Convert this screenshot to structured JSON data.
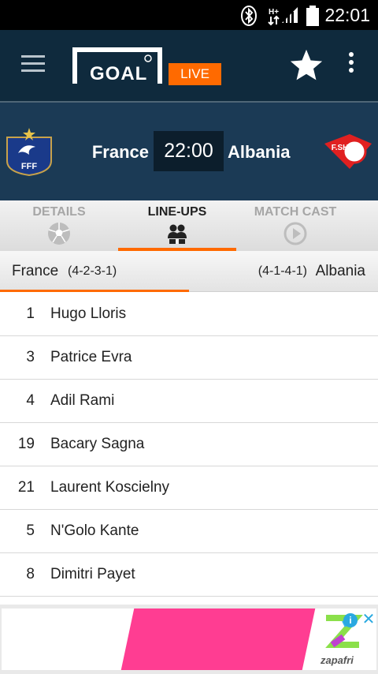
{
  "status_bar": {
    "time": "22:01",
    "icons": [
      "bluetooth-icon",
      "network-hplus-icon",
      "signal-icon",
      "battery-icon"
    ],
    "network_label": "H+"
  },
  "app_bar": {
    "logo_text": "GOAL",
    "live_label": "LIVE",
    "icons": [
      "menu-icon",
      "star-icon",
      "more-vert-icon"
    ]
  },
  "match": {
    "home_team": "France",
    "away_team": "Albania",
    "kickoff": "22:00",
    "home_crest_text": "FFF",
    "away_crest_text": "F.SH.F"
  },
  "tabs": [
    {
      "label": "DETAILS",
      "icon": "soccer-ball-icon",
      "active": false
    },
    {
      "label": "LINE-UPS",
      "icon": "players-icon",
      "active": true
    },
    {
      "label": "MATCH CAST",
      "icon": "play-circle-icon",
      "active": false
    }
  ],
  "lineups": {
    "home_name": "France",
    "home_formation": "(4-2-3-1)",
    "away_formation": "(4-1-4-1)",
    "away_name": "Albania",
    "players": [
      {
        "number": "1",
        "name": "Hugo Lloris"
      },
      {
        "number": "3",
        "name": "Patrice Evra"
      },
      {
        "number": "4",
        "name": "Adil Rami"
      },
      {
        "number": "19",
        "name": "Bacary Sagna"
      },
      {
        "number": "21",
        "name": "Laurent Koscielny"
      },
      {
        "number": "5",
        "name": "N'Golo Kante"
      },
      {
        "number": "8",
        "name": "Dimitri Payet"
      }
    ]
  },
  "ad": {
    "brand": "zapafri",
    "info_label": "i",
    "close_label": "✕"
  },
  "colors": {
    "app_bar": "#0f2a3d",
    "match_header": "#1b3a55",
    "accent": "#ff6a00"
  }
}
